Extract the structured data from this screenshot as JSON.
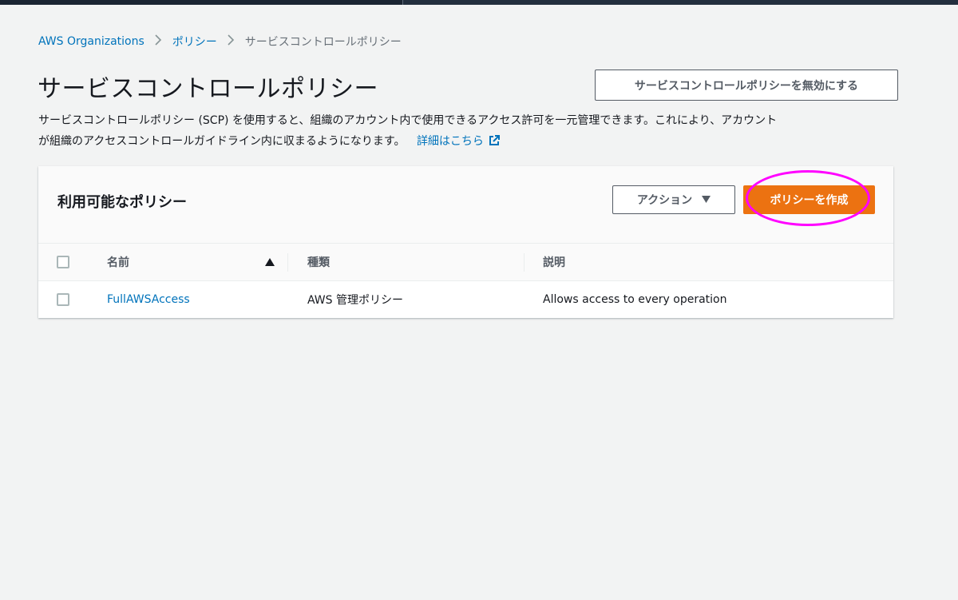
{
  "breadcrumb": {
    "items": [
      {
        "label": "AWS Organizations"
      },
      {
        "label": "ポリシー"
      },
      {
        "label": "サービスコントロールポリシー"
      }
    ]
  },
  "page": {
    "title": "サービスコントロールポリシー",
    "disable_button": "サービスコントロールポリシーを無効にする",
    "description_line1": "サービスコントロールポリシー (SCP) を使用すると、組織のアカウント内で使用できるアクセス許可を一元管理できます。これにより、アカウント",
    "description_line2": "が組織のアクセスコントロールガイドライン内に収まるようになります。",
    "learn_more": "詳細はこちら"
  },
  "panel": {
    "title": "利用可能なポリシー",
    "actions_button": "アクション",
    "create_button": "ポリシーを作成",
    "columns": {
      "name": "名前",
      "type": "種類",
      "description": "説明"
    },
    "rows": [
      {
        "name": "FullAWSAccess",
        "type": "AWS 管理ポリシー",
        "description": "Allows access to every operation"
      }
    ]
  },
  "colors": {
    "link": "#0073bb",
    "primary": "#ec7211",
    "highlight": "#ff00ff",
    "background": "#f2f3f3"
  },
  "icons": {
    "breadcrumb_separator": "chevron-right-icon",
    "external_link": "external-link-icon",
    "actions_caret": "caret-down-icon",
    "sort": "sort-ascending-icon"
  }
}
